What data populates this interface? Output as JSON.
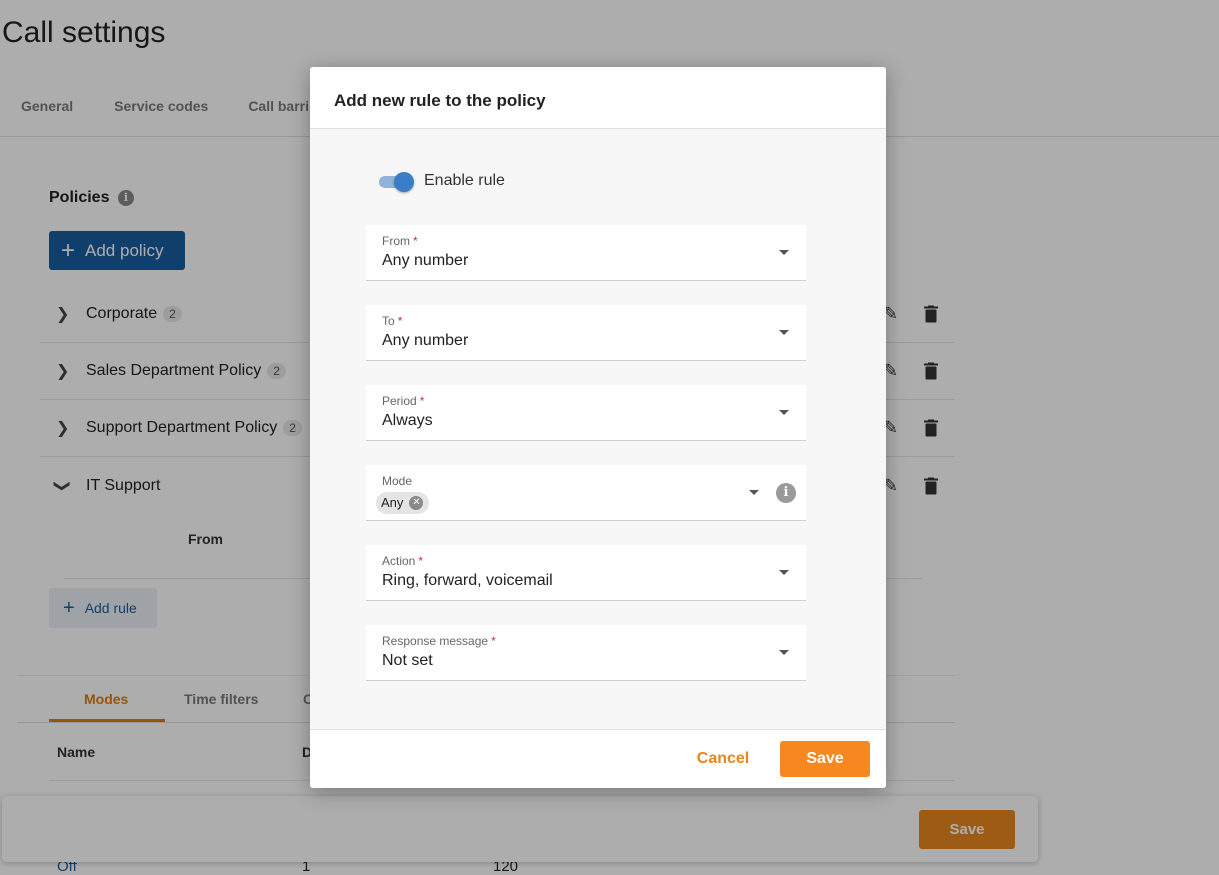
{
  "page": {
    "title": "Call settings",
    "tabs": [
      "General",
      "Service codes",
      "Call barri"
    ]
  },
  "policies": {
    "label": "Policies",
    "add_policy_label": "Add policy",
    "items": [
      {
        "name": "Corporate",
        "count": "2",
        "expanded": false
      },
      {
        "name": "Sales Department Policy",
        "count": "2",
        "expanded": false
      },
      {
        "name": "Support Department Policy",
        "count": "2",
        "expanded": false
      },
      {
        "name": "IT Support",
        "count": "",
        "expanded": true
      }
    ],
    "rules_column_from": "From",
    "add_rule_label": "Add rule"
  },
  "modes_section": {
    "tabs": [
      "Modes",
      "Time filters",
      "C"
    ],
    "active_tab": "Modes",
    "columns": [
      "Name",
      "D"
    ],
    "partial_row": [
      "Off",
      "1",
      "120"
    ]
  },
  "bottom_bar": {
    "save_label": "Save"
  },
  "modal": {
    "title": "Add new rule to the policy",
    "enable_rule_label": "Enable rule",
    "enable_rule_on": true,
    "fields": [
      {
        "label": "From",
        "required": true,
        "value": "Any number"
      },
      {
        "label": "To",
        "required": true,
        "value": "Any number"
      },
      {
        "label": "Period",
        "required": true,
        "value": "Always"
      },
      {
        "label": "Mode",
        "required": false,
        "chip": "Any"
      },
      {
        "label": "Action",
        "required": true,
        "value": "Ring, forward, voicemail"
      },
      {
        "label": "Response message",
        "required": true,
        "value": "Not set"
      }
    ],
    "required_marker": "*",
    "cancel_label": "Cancel",
    "save_label": "Save"
  },
  "colors": {
    "accent_orange": "#f7871f",
    "primary_blue": "#1a5d9e",
    "toggle_blue": "#3b7ec8",
    "required_red": "#d32f2f"
  }
}
